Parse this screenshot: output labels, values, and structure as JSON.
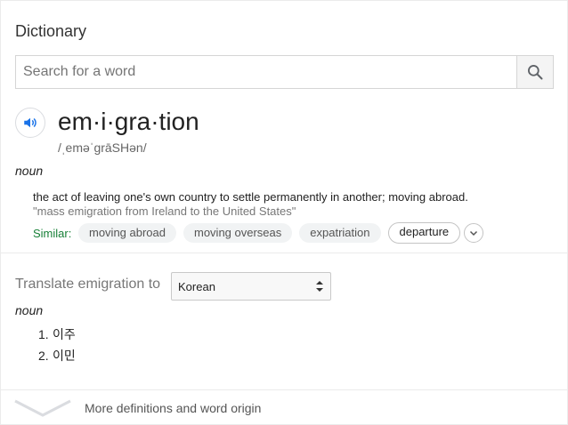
{
  "header": {
    "title": "Dictionary"
  },
  "search": {
    "placeholder": "Search for a word",
    "value": ""
  },
  "entry": {
    "word": "em·i·gra·tion",
    "phonetic": "/ˌeməˈɡrāSHən/",
    "part_of_speech": "noun",
    "definition": "the act of leaving one's own country to settle permanently in another; moving abroad.",
    "example": "\"mass emigration from Ireland to the United States\"",
    "similar_label": "Similar:",
    "similar": [
      "moving abroad",
      "moving overseas",
      "expatriation",
      "departure"
    ]
  },
  "translate": {
    "label": "Translate emigration to",
    "language": "Korean",
    "part_of_speech": "noun",
    "items": [
      {
        "num": "1.",
        "text": "이주"
      },
      {
        "num": "2.",
        "text": "이민"
      }
    ]
  },
  "footer": {
    "more_label": "More definitions and word origin"
  },
  "icons": {
    "search": "search-icon",
    "audio": "speaker-icon",
    "expand": "chevron-down-icon",
    "more": "chevron-down-icon"
  },
  "colors": {
    "similar_label": "#188038",
    "audio_icon": "#1a73e8"
  }
}
